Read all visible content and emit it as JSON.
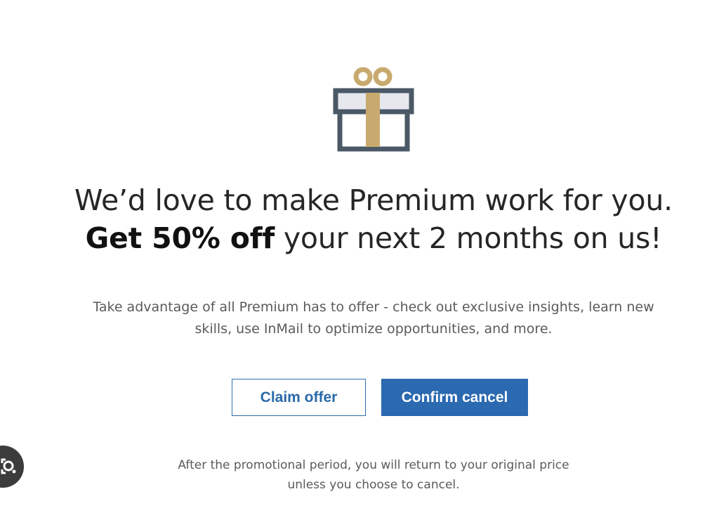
{
  "gift_icon": "gift-icon",
  "colors": {
    "ribbon": "#c8aa6e",
    "box_outline": "#4b5866",
    "lid_fill": "#e6e8ee",
    "primary_button": "#2b69b0",
    "link_blue": "#2a6aa8"
  },
  "headline": {
    "line1": "We’d love to make Premium work for you.",
    "line2_bold": "Get 50% off",
    "line2_rest": " your next 2 months on us!"
  },
  "description": "Take advantage of all Premium has to offer - check out exclusive insights, learn new skills, use InMail to optimize opportunities, and more.",
  "buttons": {
    "claim_offer": "Claim offer",
    "confirm_cancel": "Confirm cancel"
  },
  "footnote": "After the promotional period, you will return to your original price unless you choose to cancel.",
  "overlay_icon": "lens-search-icon"
}
